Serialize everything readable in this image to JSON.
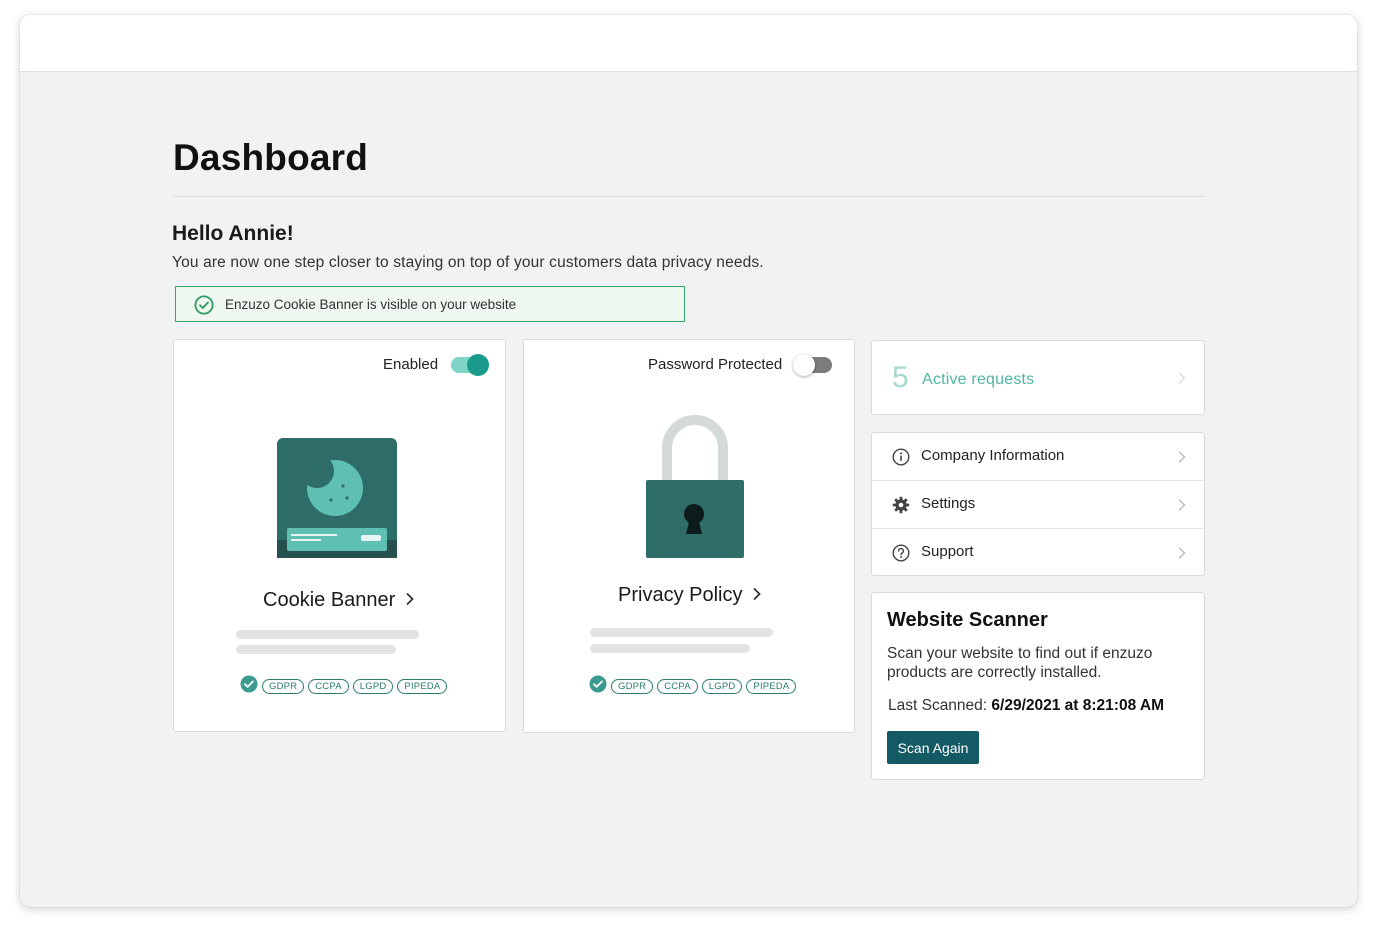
{
  "page": {
    "title": "Dashboard",
    "greeting": "Hello Annie!",
    "intro": "You are now one step closer to staying on top of your customers data privacy needs."
  },
  "notice": {
    "text": "Enzuzo Cookie Banner is visible on your website",
    "icon": "check-circle-icon",
    "color": "#3aa86b"
  },
  "cookie_card": {
    "toggle_label": "Enabled",
    "toggle_on": true,
    "title": "Cookie Banner",
    "badges": [
      "GDPR",
      "CCPA",
      "LGPD",
      "PIPEDA"
    ]
  },
  "privacy_card": {
    "toggle_label": "Password Protected",
    "toggle_on": false,
    "title": "Privacy Policy",
    "badges": [
      "GDPR",
      "CCPA",
      "LGPD",
      "PIPEDA"
    ]
  },
  "requests": {
    "count": "5",
    "label": "Active requests"
  },
  "links": [
    {
      "label": "Company Information",
      "icon": "info-icon"
    },
    {
      "label": "Settings",
      "icon": "gear-icon"
    },
    {
      "label": "Support",
      "icon": "help-circle-icon"
    }
  ],
  "scanner": {
    "title": "Website Scanner",
    "description": "Scan your website to find out if enzuzo products are correctly installed.",
    "last_label": "Last Scanned: ",
    "last_value": "6/29/2021 at 8:21:08 AM",
    "button_label": "Scan Again"
  },
  "colors": {
    "accent": "#1a9a8b",
    "button": "#145a65",
    "illustration": "#2b6e68"
  }
}
